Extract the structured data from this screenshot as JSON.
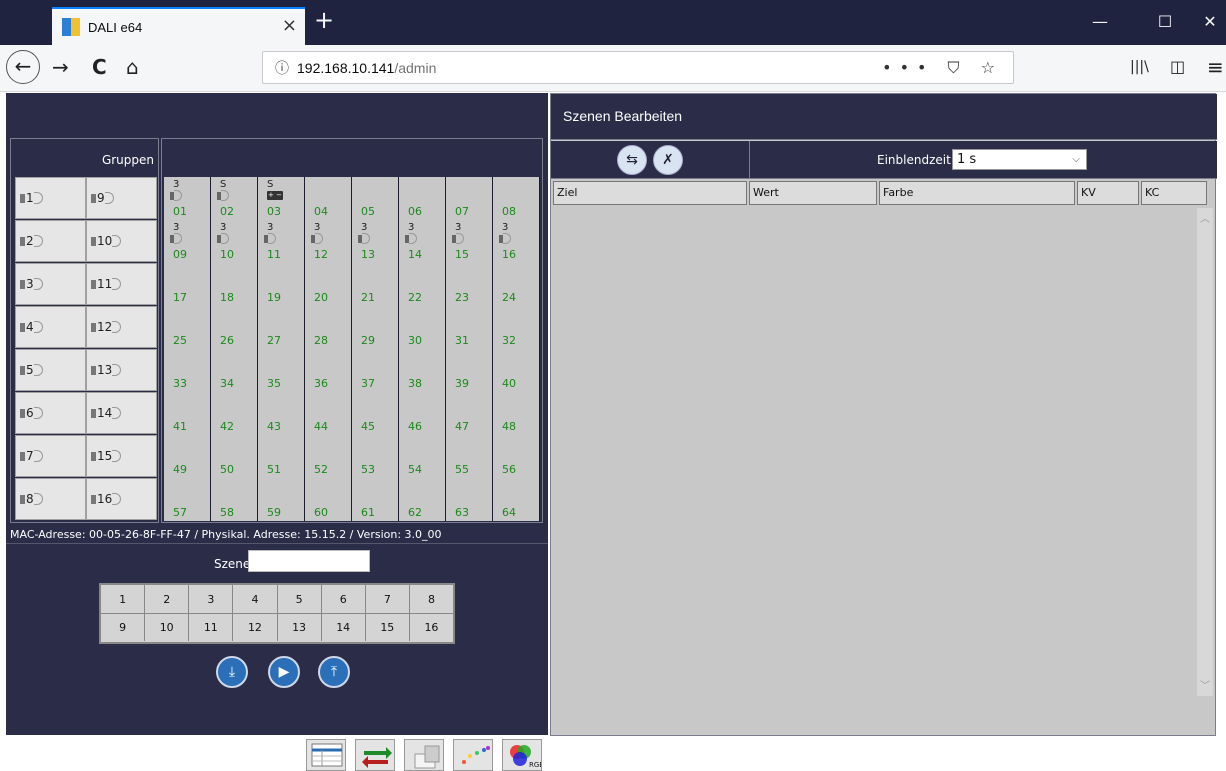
{
  "browser": {
    "tab_title": "DALI e64",
    "tab_close": "×",
    "new_tab": "+",
    "url_host": "192.168.10.141",
    "url_path": "/admin",
    "url_actions": "••• ⛉ ☆",
    "window_controls": {
      "minimize": "—",
      "maximize": "☐",
      "close": "✕"
    },
    "nav_icons": {
      "back": "←",
      "forward": "→",
      "reload": "C",
      "home": "⌂",
      "library": "|||\\",
      "sidebar": "◫",
      "menu": "≡"
    }
  },
  "left": {
    "groups_title": "Gruppen",
    "groups": [
      [
        "1",
        "9"
      ],
      [
        "2",
        "10"
      ],
      [
        "3",
        "11"
      ],
      [
        "4",
        "12"
      ],
      [
        "5",
        "13"
      ],
      [
        "6",
        "14"
      ],
      [
        "7",
        "15"
      ],
      [
        "8",
        "16"
      ]
    ],
    "devices": [
      [
        "01",
        "02",
        "03",
        "04",
        "05",
        "06",
        "07",
        "08"
      ],
      [
        "09",
        "10",
        "11",
        "12",
        "13",
        "14",
        "15",
        "16"
      ],
      [
        "17",
        "18",
        "19",
        "20",
        "21",
        "22",
        "23",
        "24"
      ],
      [
        "25",
        "26",
        "27",
        "28",
        "29",
        "30",
        "31",
        "32"
      ],
      [
        "33",
        "34",
        "35",
        "36",
        "37",
        "38",
        "39",
        "40"
      ],
      [
        "41",
        "42",
        "43",
        "44",
        "45",
        "46",
        "47",
        "48"
      ],
      [
        "49",
        "50",
        "51",
        "52",
        "53",
        "54",
        "55",
        "56"
      ],
      [
        "57",
        "58",
        "59",
        "60",
        "61",
        "62",
        "63",
        "64"
      ]
    ],
    "device_marks": {
      "01": "3",
      "02": "S",
      "03": "S",
      "09": "3",
      "10": "3",
      "11": "3",
      "12": "3",
      "13": "3",
      "14": "3",
      "15": "3",
      "16": "3"
    },
    "battery_label": "+ −",
    "mac_info": "MAC-Adresse: 00-05-26-8F-FF-47 / Physikal. Adresse: 15.15.2 / Version: 3.0_00",
    "szenen_label": "Szenen",
    "szenen_value": "",
    "scene_numbers": [
      [
        "1",
        "2",
        "3",
        "4",
        "5",
        "6",
        "7",
        "8"
      ],
      [
        "9",
        "10",
        "11",
        "12",
        "13",
        "14",
        "15",
        "16"
      ]
    ]
  },
  "right": {
    "title": "Szenen Bearbeiten",
    "einblendzeit_label": "Einblendzeit",
    "einblendzeit_value": "1 s",
    "columns": [
      "Ziel",
      "Wert",
      "Farbe",
      "KV",
      "KC"
    ]
  },
  "colors": {
    "panel_bg": "#2b2d48",
    "cell_bg": "#c8c8c8",
    "device_number": "#1b8a1b",
    "accent_blue": "#2a6fb8"
  },
  "icons": {
    "scene_action_buttons": [
      "store-scene-icon",
      "play-icon",
      "recall-scene-icon"
    ],
    "toolbar_buttons": [
      "list-view-icon",
      "swap-arrows-icon",
      "layers-icon",
      "color-dots-icon",
      "rgb-icon"
    ],
    "rgb_label": "RGB"
  }
}
